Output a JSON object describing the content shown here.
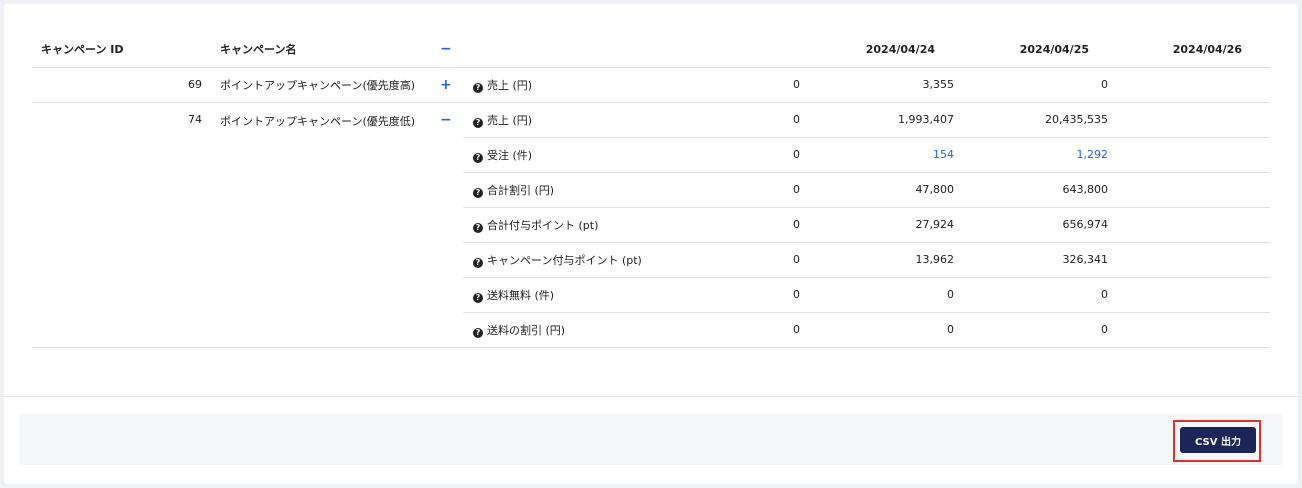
{
  "header": {
    "campaign_id": "キャンペーン ID",
    "campaign_name": "キャンペーン名",
    "collapse_all": "−",
    "dates": [
      "2024/04/24",
      "2024/04/25",
      "2024/04/26"
    ]
  },
  "rows": [
    {
      "id": "69",
      "name": "ポイントアップキャンペーン(優先度高)",
      "toggle": "+",
      "metric": "売上 (円)",
      "values": [
        "0",
        "3,355",
        "0"
      ]
    },
    {
      "id": "74",
      "name": "ポイントアップキャンペーン(優先度低)",
      "toggle": "−",
      "metric": "売上 (円)",
      "values": [
        "0",
        "1,993,407",
        "20,435,535"
      ]
    },
    {
      "metric": "受注 (件)",
      "values": [
        "0",
        "154",
        "1,292"
      ]
    },
    {
      "metric": "合計割引 (円)",
      "values": [
        "0",
        "47,800",
        "643,800"
      ]
    },
    {
      "metric": "合計付与ポイント (pt)",
      "values": [
        "0",
        "27,924",
        "656,974"
      ]
    },
    {
      "metric": "キャンペーン付与ポイント (pt)",
      "values": [
        "0",
        "13,962",
        "326,341"
      ]
    },
    {
      "metric": "送料無料 (件)",
      "values": [
        "0",
        "0",
        "0"
      ]
    },
    {
      "metric": "送料の割引 (円)",
      "values": [
        "0",
        "0",
        "0"
      ]
    }
  ],
  "help_glyph": "?",
  "footer": {
    "csv_button": "CSV 出力"
  },
  "colors": {
    "link": "#2563eb",
    "button": "#1b2557",
    "highlight_border": "#d9352b"
  }
}
